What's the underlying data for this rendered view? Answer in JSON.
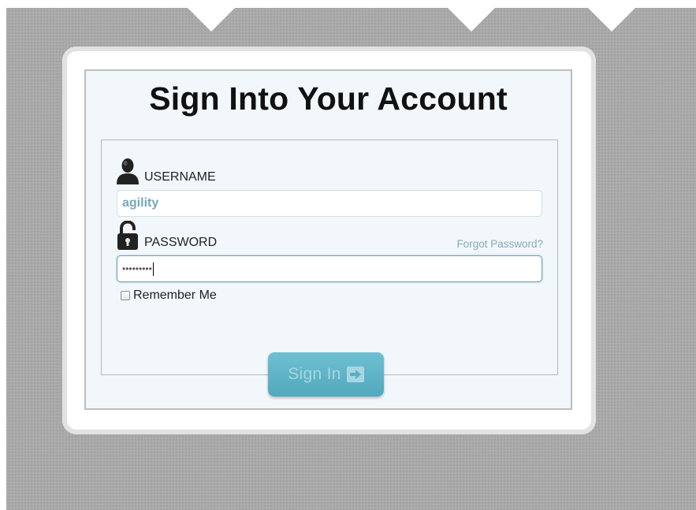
{
  "login": {
    "title": "Sign Into Your Account",
    "username_label": "USERNAME",
    "username_value": "agility",
    "password_label": "PASSWORD",
    "password_value": "•••••••••",
    "forgot_link": "Forgot Password?",
    "remember_label": "Remember Me",
    "remember_checked": false,
    "submit_label": "Sign In"
  },
  "icons": {
    "user": "user-icon",
    "lock": "lock-icon",
    "arrow": "arrow-right-icon"
  },
  "colors": {
    "background": "#a9a9a9",
    "panel": "#f1f7fa",
    "accent": "#5db3c6",
    "link": "#8aa9b8"
  }
}
